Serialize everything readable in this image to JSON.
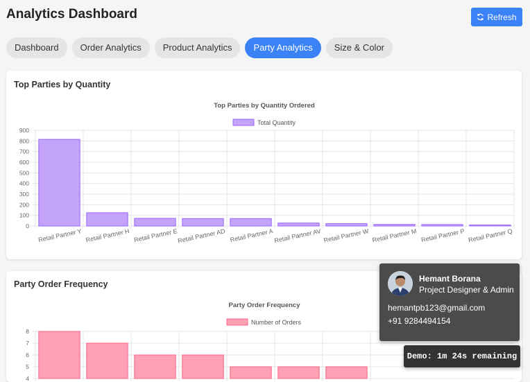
{
  "header": {
    "title": "Analytics Dashboard",
    "refresh_label": "Refresh",
    "refresh_icon": "refresh-icon"
  },
  "tabs": [
    {
      "label": "Dashboard",
      "active": false
    },
    {
      "label": "Order Analytics",
      "active": false
    },
    {
      "label": "Product Analytics",
      "active": false
    },
    {
      "label": "Party Analytics",
      "active": true
    },
    {
      "label": "Size & Color",
      "active": false
    }
  ],
  "card1": {
    "title": "Top Parties by Quantity"
  },
  "card2": {
    "title": "Party Order Frequency"
  },
  "chart_data": [
    {
      "type": "bar",
      "title": "Top Parties by Quantity Ordered",
      "categories": [
        "Retail Partner Y",
        "Retail Partner H",
        "Retail Partner E",
        "Retail Partner AD",
        "Retail Partner A",
        "Retail Partner AV",
        "Retail Partner W",
        "Retail Partner M",
        "Retail Partner P",
        "Retail Partner Q"
      ],
      "series": [
        {
          "name": "Total Quantity",
          "values": [
            815,
            125,
            72,
            70,
            70,
            28,
            22,
            15,
            14,
            10
          ]
        }
      ],
      "ylim": [
        0,
        900
      ],
      "yticks": [
        0,
        100,
        200,
        300,
        400,
        500,
        600,
        700,
        800,
        900
      ],
      "grid": true,
      "legend": "top",
      "colors": {
        "fill": "#c4a3fb",
        "stroke": "#9966ff"
      }
    },
    {
      "type": "bar",
      "title": "Party Order Frequency",
      "categories": [
        "",
        "",
        "",
        "",
        "",
        "",
        ""
      ],
      "series": [
        {
          "name": "Number of Orders",
          "values": [
            8,
            7,
            6,
            6,
            5,
            5,
            5
          ]
        }
      ],
      "ylim": [
        4,
        8
      ],
      "yticks": [
        4,
        5,
        6,
        7,
        8
      ],
      "grid": true,
      "legend": "top",
      "colors": {
        "fill": "#ffa1b5",
        "stroke": "#ff6384"
      }
    }
  ],
  "profile": {
    "name": "Hemant Borana",
    "role": "Project Designer & Admin",
    "email": "hemantpb123@gmail.com",
    "phone": "+91 9284494154"
  },
  "demo": {
    "text": "Demo: 1m 24s remaining"
  }
}
